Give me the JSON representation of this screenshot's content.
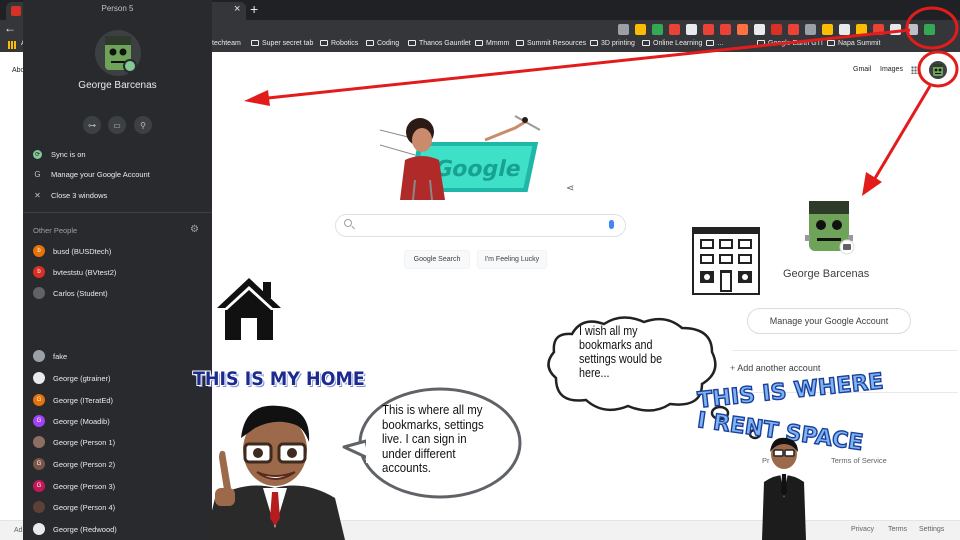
{
  "browser": {
    "tab_title": "Person 5",
    "close_glyph": "×",
    "newtab_glyph": "+",
    "back_glyph": "←",
    "bookmarks": [
      {
        "label": "A"
      },
      {
        "label": "techteam"
      },
      {
        "label": "Super secret tab"
      },
      {
        "label": "Robotics"
      },
      {
        "label": "Coding"
      },
      {
        "label": "Thanos Gauntlet"
      },
      {
        "label": "Mmmm"
      },
      {
        "label": "Summit Resources"
      },
      {
        "label": "3D printing"
      },
      {
        "label": "Online Learning"
      },
      {
        "label": "…"
      },
      {
        "label": "Google Earth GTI"
      },
      {
        "label": "Napa Summit"
      }
    ],
    "extension_colors": [
      "#9aa0a6",
      "#fbbc04",
      "#34a853",
      "#ea4335",
      "#e8eaed",
      "#ea4335",
      "#ea4335",
      "#ff7043",
      "#e8eaed",
      "#d93025",
      "#ea4335",
      "#9aa0a6",
      "#fbbc04",
      "#e8eaed",
      "#fbbc04",
      "#ea4335",
      "#e8eaed",
      "#bdc1c6",
      "#34a853"
    ]
  },
  "profile_menu": {
    "title": "Person 5",
    "name": "George Barcenas",
    "chips": [
      {
        "icon": "key-icon",
        "glyph": "⊶"
      },
      {
        "icon": "card-icon",
        "glyph": "▭"
      },
      {
        "icon": "location-icon",
        "glyph": "⚲"
      }
    ],
    "items": [
      {
        "icon": "sync-icon",
        "glyph": "⟳",
        "label": "Sync is on"
      },
      {
        "icon": "google-icon",
        "glyph": "G",
        "label": "Manage your Google Account"
      },
      {
        "icon": "close-icon",
        "glyph": "✕",
        "label": "Close 3 windows"
      }
    ],
    "other_people_label": "Other People",
    "gear_glyph": "⚙",
    "people": [
      {
        "label": "busd (BUSDtech)",
        "initial": "b",
        "color": "#e8710a"
      },
      {
        "label": "bvteststu (BVtest2)",
        "initial": "b",
        "color": "#d93025"
      },
      {
        "label": "Carlos (Student)",
        "initial": "",
        "color": "#5f6368"
      },
      {
        "label": "fake",
        "initial": "",
        "color": "#9aa0a6"
      },
      {
        "label": "George (gtrainer)",
        "initial": "",
        "color": "#e8eaed"
      },
      {
        "label": "George (ITeratEd)",
        "initial": "G",
        "color": "#e8710a"
      },
      {
        "label": "George (Moadib)",
        "initial": "G",
        "color": "#a142f4"
      },
      {
        "label": "George (Person 1)",
        "initial": "",
        "color": "#8d6e63"
      },
      {
        "label": "George (Person 2)",
        "initial": "G",
        "color": "#795548"
      },
      {
        "label": "George (Person 3)",
        "initial": "G",
        "color": "#c2185b"
      },
      {
        "label": "George (Person 4)",
        "initial": "",
        "color": "#5d4037"
      },
      {
        "label": "George (Redwood)",
        "initial": "",
        "color": "#e8eaed"
      }
    ]
  },
  "google_page": {
    "about": "Abo",
    "advertising": "Ad",
    "gmail": "Gmail",
    "images": "Images",
    "search_button": "Google Search",
    "lucky_button": "I'm Feeling Lucky",
    "footer_links": [
      "Privacy",
      "Terms",
      "Settings"
    ]
  },
  "account_card": {
    "name": "George Barcenas",
    "manage_button": "Manage your Google Account",
    "add_account": "Add another account",
    "privacy_policy": "Pr",
    "terms": "Terms of Service"
  },
  "annotations": {
    "home_title": "THIS IS MY HOME",
    "home_bubble": "This is where all my bookmarks, settings live. I can sign in under different accounts.",
    "wish_bubble": "I wish all my bookmarks and settings would be here...",
    "rent_title_line1": "THIS IS WHERE",
    "rent_title_line2": "I RENT SPACE"
  },
  "colors": {
    "arrow": "#e21b1b",
    "panel": "#292a2d",
    "home_title": "#1d2b8f"
  }
}
